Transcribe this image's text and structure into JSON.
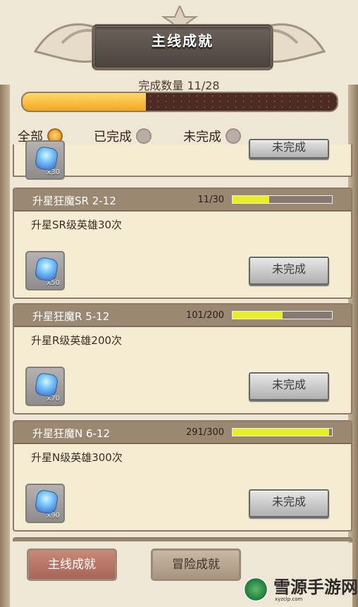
{
  "header": {
    "title": "主线成就",
    "count_label": "完成数量 11/28",
    "progress_fraction": 0.393,
    "colors": {
      "fill": "#f2a81e",
      "track": "#4b2b23"
    }
  },
  "filters": [
    {
      "label": "全部",
      "selected": true
    },
    {
      "label": "已完成",
      "selected": false
    },
    {
      "label": "未完成",
      "selected": false
    }
  ],
  "partial_item": {
    "qty": "x30",
    "status": "未完成"
  },
  "achievements": [
    {
      "title": "升星狂魔SR 2-12",
      "progress_text": "11/30",
      "progress_fraction": 0.367,
      "description": "升星SR级英雄30次",
      "reward_qty": "x50",
      "status": "未完成"
    },
    {
      "title": "升星狂魔R 5-12",
      "progress_text": "101/200",
      "progress_fraction": 0.505,
      "description": "升星R级英雄200次",
      "reward_qty": "x70",
      "status": "未完成"
    },
    {
      "title": "升星狂魔N 6-12",
      "progress_text": "291/300",
      "progress_fraction": 0.97,
      "description": "升星N级英雄300次",
      "reward_qty": "x90",
      "status": "未完成"
    }
  ],
  "tabs": [
    {
      "label": "主线成就",
      "active": true
    },
    {
      "label": "冒险成就",
      "active": false
    }
  ],
  "watermark": {
    "text": "雪源手游网",
    "url": "xyzclp.com"
  }
}
